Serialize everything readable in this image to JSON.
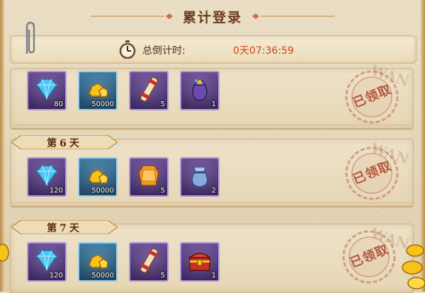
{
  "title": "累计登录",
  "timer": {
    "label": "总倒计时:",
    "value": "0天07:36:59"
  },
  "cards": [
    {
      "day_label": "",
      "stamp_text": "已领取",
      "items": [
        {
          "icon": "diamond-icon",
          "frame": "purple",
          "qty": "80"
        },
        {
          "icon": "gold-nugget-icon",
          "frame": "blue",
          "qty": "50000"
        },
        {
          "icon": "scroll-icon",
          "frame": "purple",
          "qty": "5"
        },
        {
          "icon": "treasure-bag-icon",
          "frame": "purple",
          "qty": "1"
        }
      ]
    },
    {
      "day_label": "第6天",
      "stamp_text": "已领取",
      "items": [
        {
          "icon": "diamond-icon",
          "frame": "purple",
          "qty": "120"
        },
        {
          "icon": "gold-nugget-icon",
          "frame": "blue",
          "qty": "50000"
        },
        {
          "icon": "amber-gem-icon",
          "frame": "purple",
          "qty": "5"
        },
        {
          "icon": "pouch-icon",
          "frame": "purple",
          "qty": "2"
        }
      ]
    },
    {
      "day_label": "第7天",
      "stamp_text": "已领取",
      "items": [
        {
          "icon": "diamond-icon",
          "frame": "purple",
          "qty": "120"
        },
        {
          "icon": "gold-nugget-icon",
          "frame": "blue",
          "qty": "50000"
        },
        {
          "icon": "scroll-icon",
          "frame": "purple",
          "qty": "5"
        },
        {
          "icon": "treasure-chest-icon",
          "frame": "purple",
          "qty": "1"
        }
      ]
    }
  ],
  "watermark_text": "WAN",
  "colors": {
    "title": "#6b3a1f",
    "timer_value": "#d0451c",
    "stamp": "#b4573f",
    "frame_purple": "#b09ad8",
    "frame_blue": "#9bd0ea"
  }
}
